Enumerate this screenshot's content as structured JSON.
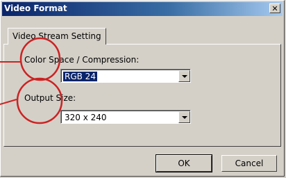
{
  "window": {
    "title": "Video Format",
    "close_glyph": "✕"
  },
  "tabs": [
    {
      "label": "Video Stream Setting",
      "active": true
    }
  ],
  "color_space": {
    "label": "Color Space / Compression:",
    "value": "RGB 24"
  },
  "output_size": {
    "label": "Output Size:",
    "value": "320 x 240"
  },
  "buttons": {
    "ok": "OK",
    "cancel": "Cancel"
  },
  "colors": {
    "titlebar": "#0a246a",
    "selection": "#0a246a",
    "annotation": "#cc2222",
    "face": "#d4d0c8"
  }
}
